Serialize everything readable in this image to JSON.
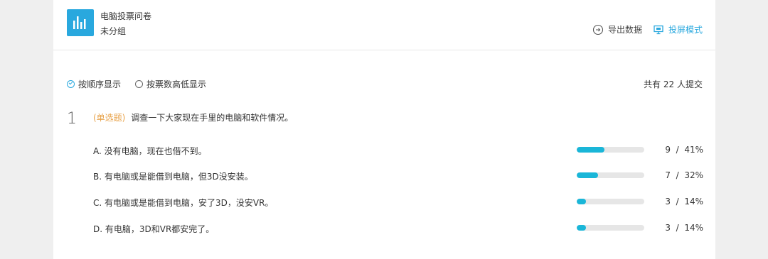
{
  "header": {
    "title": "电脑投票问卷",
    "group": "未分组",
    "export_label": "导出数据",
    "present_label": "投屏模式",
    "accent_color": "#29a8de"
  },
  "sort": {
    "options": [
      {
        "label": "按顺序显示",
        "checked": true
      },
      {
        "label": "按票数高低显示",
        "checked": false
      }
    ]
  },
  "summary": {
    "text": "共有 22 人提交"
  },
  "question": {
    "number": "1",
    "type": "(单选题)",
    "text": "调查一下大家现在手里的电脑和软件情况。",
    "options": [
      {
        "label": "A. 没有电脑，现在也借不到。",
        "count": "9",
        "percent": "41%",
        "ratio": 0.41
      },
      {
        "label": "B. 有电脑或是能借到电脑，但3D没安装。",
        "count": "7",
        "percent": "32%",
        "ratio": 0.32
      },
      {
        "label": "C. 有电脑或是能借到电脑，安了3D，没安VR。",
        "count": "3",
        "percent": "14%",
        "ratio": 0.14
      },
      {
        "label": "D. 有电脑，3D和VR都安完了。",
        "count": "3",
        "percent": "14%",
        "ratio": 0.14
      }
    ]
  }
}
